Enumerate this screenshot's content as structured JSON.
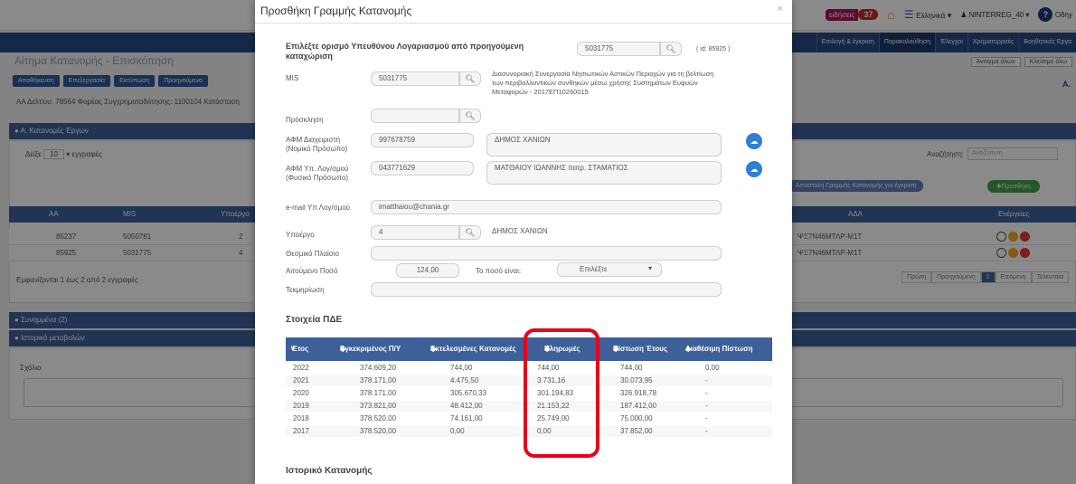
{
  "app": {
    "notifications_label": "ειδήσεις",
    "notifications_count": "37",
    "language": "Ελληνικά",
    "user": "NINTERREG_40",
    "help_label": "Οδηγ",
    "nav": [
      "Επιλογή & έγκριση",
      "Παρακολούθηση",
      "Έλεγχοι",
      "Χρηματορροές",
      "Βοηθητικές Εργα"
    ],
    "page_title": "Αίτημα Κατανομής - Επισκόπηση",
    "buttons": [
      "Αποθήκευση",
      "Επεξεργασία",
      "Εκτύπωση",
      "Προηγούμενο"
    ],
    "right_controls": [
      "Άνοιγμα όλων",
      "Κλείσιμο όλω"
    ],
    "info_line": "ΑΑ Δελτίου: 78564   Φορέας Συγχρηματοδότησης: 1100104   Κατάσταση",
    "a_right": "Α.",
    "section_a": "Α. Κατανομές Έργων",
    "show_label": "Δείξε",
    "show_value": "10",
    "show_suffix": "εγγραφές",
    "search_label": "Αναζήτηση:",
    "search_placeholder": "Αναζήτηση",
    "approve_btn": "Αποστολή Γραμμής Κατανομής για έγκριση",
    "add_btn": "Προσθήκη",
    "table_headers": [
      "ΑΑ",
      "MIS",
      "Υποέργο",
      "ΑΔΑ",
      "Ενέργειες"
    ],
    "rows": [
      {
        "aa": "85237",
        "mis": "5050781",
        "sub": "2",
        "ada": "ΨΞ7Ν46ΜΤΛΡ-Μ1Τ"
      },
      {
        "aa": "85925",
        "mis": "5031775",
        "sub": "4",
        "ada": "ΨΞ7Ν46ΜΤΛΡ-Μ1Τ"
      }
    ],
    "showing": "Εμφανίζονται 1 έως 2 από 2 εγγραφές",
    "pager": [
      "Πρώτη",
      "Προηγούμενη",
      "1",
      "Επόμενη",
      "Τελευταία"
    ],
    "section_related": "Συνημμένα (2)",
    "section_history": "Ιστορικό μεταβολών",
    "comments_label": "Σχόλια"
  },
  "modal": {
    "title": "Προσθήκη Γραμμής Κατανομής",
    "close": "×",
    "select_prev_label": "Επιλέξτε ορισμό Υπευθύνου Λογαριασμού από προηγούμενη καταχώριση",
    "select_prev_value": "5031775",
    "select_prev_id": "( id: 85925 )",
    "mis_label": "MIS",
    "mis_value": "5031775",
    "mis_description": "Διασυνοριακή Συνεργασία Νησιωτικών Αστικών Περιοχών για τη βελτίωση των περιβαλλοντικών συνθηκών μέσω χρήσης Συστημάτων Ευφυών Μεταφορών - 2017ΕΠ10260015",
    "invitation_label": "Πρόσκληση",
    "invitation_value": "",
    "afm_manager_label": "ΑΦΜ Διαχειριστή (Νομικό Πρόσωπο)",
    "afm_manager_value": "997678759",
    "afm_manager_name": "ΔΗΜΟΣ ΧΑΝΙΩΝ",
    "afm_account_label": "ΑΦΜ Υπ. Λογ/σμού (Φυσικό Πρόσωπο)",
    "afm_account_value": "043771629",
    "afm_account_name": "ΜΑΤΘΑΙΟΥ ΙΩΑΝΝΗΣ πατρ. ΣΤΑΜΑΤΙΟΣ",
    "email_label": "e-mail Υπ Λογ/σμού",
    "email_value": "imatthaiou@chania.gr",
    "subproject_label": "Υποέργο",
    "subproject_value": "4",
    "subproject_name": "ΔΗΜΟΣ ΧΑΝΙΩΝ",
    "framework_label": "Θεσμικό Πλαίσιο",
    "framework_value": "",
    "amount_label": "Αιτούμενο Ποσό",
    "amount_value": "124,00",
    "amount_type_label": "Το ποσό είναι:",
    "amount_type_value": "Επιλέξτε",
    "justification_label": "Τεκμηρίωση",
    "justification_value": "",
    "pde_title": "Στοιχεία ΠΔΕ",
    "history_title": "Ιστορικό Κατανομής",
    "table": {
      "headers": [
        "Έτος",
        "Εγκεκριμένος Π/Υ",
        "Εκτελεσμένες Κατανομές",
        "Πληρωμές",
        "Πίστωση Έτους",
        "Διαθέσιμη Πίστωση"
      ],
      "rows": [
        [
          "2022",
          "374.609,20",
          "744,00",
          "744,00",
          "744,00",
          "0,00"
        ],
        [
          "2021",
          "378.171,00",
          "4.475,50",
          "3.731,16",
          "30.073,95",
          "-"
        ],
        [
          "2020",
          "378.171,00",
          "305.670,33",
          "301.194,83",
          "326.918,78",
          "-"
        ],
        [
          "2019",
          "373.821,00",
          "48.412,00",
          "21.153,22",
          "187.412,00",
          "-"
        ],
        [
          "2018",
          "378.520,00",
          "74.161,00",
          "25.749,00",
          "75.000,00",
          "-"
        ],
        [
          "2017",
          "378.520,00",
          "0,00",
          "0,00",
          "37.852,00",
          "-"
        ]
      ]
    }
  }
}
